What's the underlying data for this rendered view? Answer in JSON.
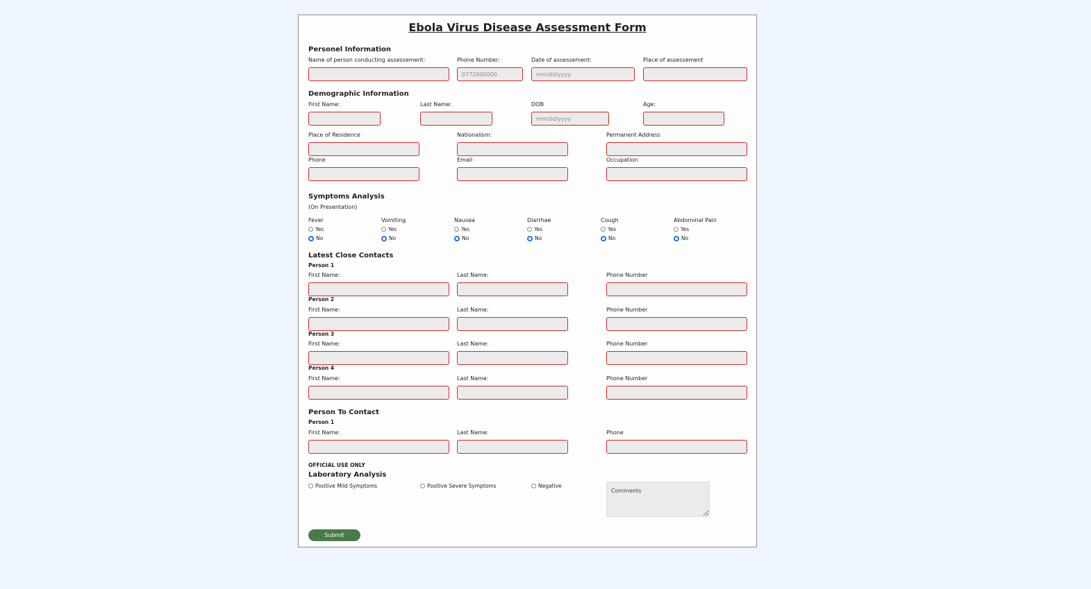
{
  "title": "Ebola Virus Disease Assessment Form",
  "personnel": {
    "heading": "Personel Information",
    "name_label": "Name of person conducting assessement:",
    "phone_label": "Phone Number:",
    "phone_placeholder": "0772000000",
    "date_label": "Date of assessement:",
    "date_placeholder": "mm/dd/yyyy",
    "place_label": "Place of assessement"
  },
  "demographic": {
    "heading": "Demographic Information",
    "first_name_label": "First Name:",
    "last_name_label": "Last Name:",
    "dob_label": "DOB",
    "dob_placeholder": "mm/dd/yyyy",
    "age_label": "Age:",
    "residence_label": "Place of Residence",
    "nationalism_label": "Nationalism:",
    "address_label": "Permanent Address",
    "phone_label": "Phone",
    "email_label": "Email",
    "occupation_label": "Occupation"
  },
  "symptoms": {
    "heading": "Symptoms Analysis",
    "subheading": "(On Presentation)",
    "yes_label": "Yes",
    "no_label": "No",
    "items": [
      {
        "label": "Fever",
        "selected": "No"
      },
      {
        "label": "Vomiting",
        "selected": "No"
      },
      {
        "label": "Nausea",
        "selected": "No"
      },
      {
        "label": "Diarrhae",
        "selected": "No"
      },
      {
        "label": "Cough",
        "selected": "No"
      },
      {
        "label": "Abdominal Pain",
        "selected": "No"
      }
    ]
  },
  "contacts": {
    "heading": "Latest Close Contacts",
    "first_name_label": "First Name:",
    "last_name_label": "Last Name:",
    "phone_label": "Phone Number",
    "persons": [
      "Person 1",
      "Person 2",
      "Person 3",
      "Person 4"
    ]
  },
  "person_to_contact": {
    "heading": "Person To Contact",
    "person_label": "Person 1",
    "first_name_label": "First Name:",
    "last_name_label": "Last Name:",
    "phone_label": "Phone"
  },
  "official": {
    "label": "OFFICIAL USE ONLY",
    "heading": "Laboratory Analysis",
    "options": [
      "Positive Mild Symptoms",
      "Positive Severe Symptoms",
      "Negative"
    ],
    "comments_placeholder": "Comments"
  },
  "submit_label": "Submit",
  "colors": {
    "background": "#eff6ff",
    "input_border": "#d62828",
    "input_fill": "#ebebeb",
    "submit": "#4a7a4a",
    "radio_selected": "#1a73e8"
  }
}
